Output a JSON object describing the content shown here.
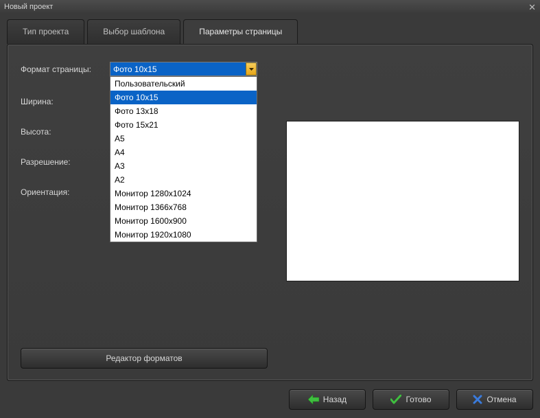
{
  "window": {
    "title": "Новый проект"
  },
  "tabs": [
    {
      "label": "Тип проекта",
      "active": false
    },
    {
      "label": "Выбор шаблона",
      "active": false
    },
    {
      "label": "Параметры страницы",
      "active": true
    }
  ],
  "form": {
    "format_label": "Формат страницы:",
    "width_label": "Ширина:",
    "height_label": "Высота:",
    "resolution_label": "Разрешение:",
    "orientation_label": "Ориентация:",
    "combo_selected": "Фото 10x15",
    "options": [
      "Пользовательский",
      "Фото 10x15",
      "Фото 13x18",
      "Фото 15x21",
      "A5",
      "A4",
      "A3",
      "A2",
      "Монитор 1280x1024",
      "Монитор 1366x768",
      "Монитор 1600x900",
      "Монитор 1920x1080"
    ],
    "selected_index": 1
  },
  "buttons": {
    "editor": "Редактор форматов",
    "back": "Назад",
    "done": "Готово",
    "cancel": "Отмена"
  }
}
